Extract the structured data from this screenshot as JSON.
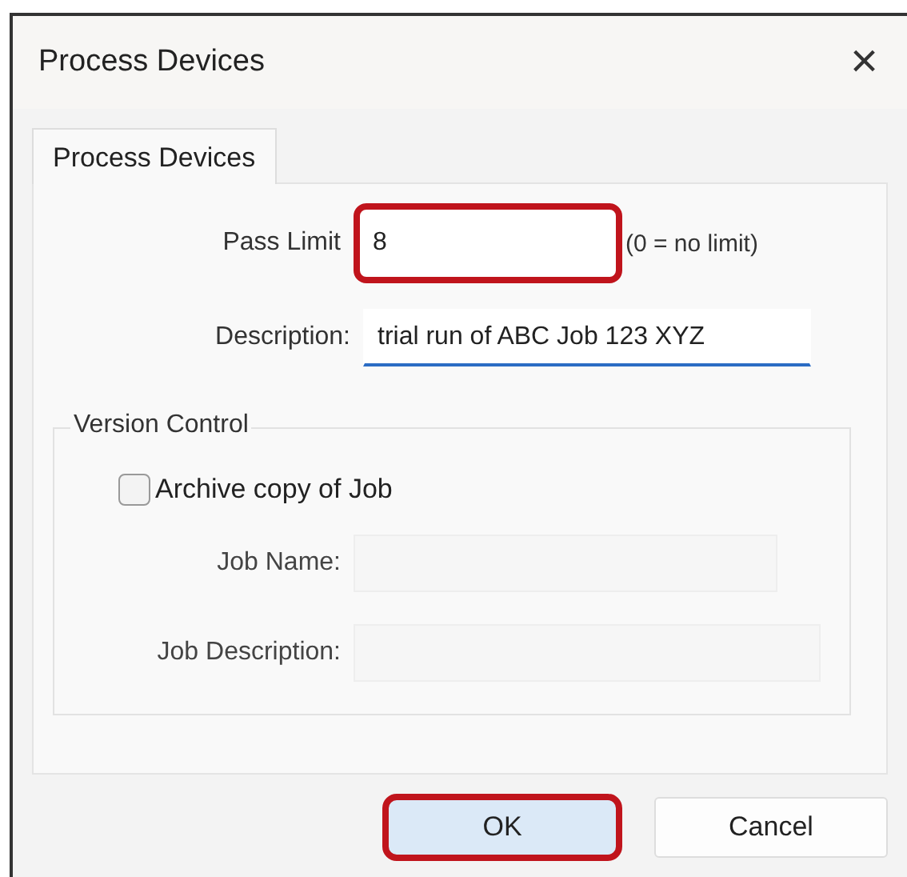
{
  "window": {
    "title": "Process Devices",
    "close": "×"
  },
  "tabs": [
    {
      "label": "Process Devices",
      "selected": true
    }
  ],
  "pass_limit": {
    "label": "Pass Limit",
    "value": "8",
    "hint": "(0 = no limit)",
    "highlighted": true
  },
  "description": {
    "label": "Description:",
    "value": "trial run of ABC Job 123 XYZ",
    "focused": true
  },
  "version_control": {
    "title": "Version Control",
    "archive": {
      "label": "Archive copy of Job",
      "checked": false
    },
    "fields": [
      {
        "label": "Job Name:",
        "disabled": true
      },
      {
        "label": "Job Description:",
        "disabled": true
      }
    ]
  },
  "buttons": [
    {
      "label": "OK",
      "highlighted": true,
      "default": true
    },
    {
      "label": "Cancel",
      "highlighted": false,
      "default": false
    }
  ]
}
